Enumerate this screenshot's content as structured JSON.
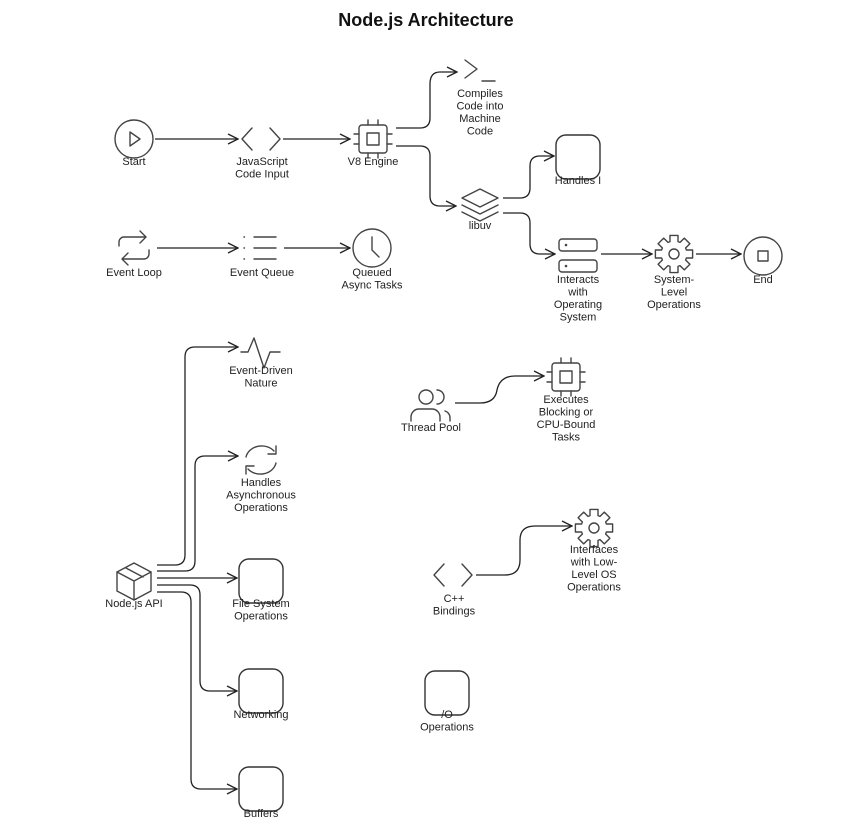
{
  "title": "Node.js Architecture",
  "nodes": {
    "start": {
      "label": [
        "Start"
      ],
      "icon": "play-circle-icon"
    },
    "js_input": {
      "label": [
        "JavaScript",
        "Code Input"
      ],
      "icon": "code-brackets-icon"
    },
    "v8": {
      "label": [
        "V8 Engine"
      ],
      "icon": "cpu-chip-icon"
    },
    "compiles": {
      "label": [
        "Compiles",
        "Code into",
        "Machine",
        "Code"
      ],
      "icon": "terminal-prompt-icon"
    },
    "libuv": {
      "label": [
        "libuv"
      ],
      "icon": "layers-icon"
    },
    "handles_io": {
      "label": [
        "Handles I"
      ],
      "icon": "rounded-box-icon"
    },
    "interacts_os": {
      "label": [
        "Interacts",
        "with",
        "Operating",
        "System"
      ],
      "icon": "server-stack-icon"
    },
    "system_ops": {
      "label": [
        "System-",
        "Level",
        "Operations"
      ],
      "icon": "gear-icon"
    },
    "end": {
      "label": [
        "End"
      ],
      "icon": "stop-circle-icon"
    },
    "event_loop": {
      "label": [
        "Event Loop"
      ],
      "icon": "repeat-arrows-icon"
    },
    "event_queue": {
      "label": [
        "Event Queue"
      ],
      "icon": "list-icon"
    },
    "queued_tasks": {
      "label": [
        "Queued",
        "Async Tasks"
      ],
      "icon": "clock-icon"
    },
    "event_driven": {
      "label": [
        "Event-Driven",
        "Nature"
      ],
      "icon": "pulse-icon"
    },
    "handles_async": {
      "label": [
        "Handles",
        "Asynchronous",
        "Operations"
      ],
      "icon": "refresh-icon"
    },
    "nodejs_api": {
      "label": [
        "Node.js API"
      ],
      "icon": "package-box-icon"
    },
    "file_system": {
      "label": [
        "File System",
        "Operations"
      ],
      "icon": "rounded-box-icon"
    },
    "networking": {
      "label": [
        "Networking"
      ],
      "icon": "rounded-box-icon"
    },
    "buffers": {
      "label": [
        "Buffers"
      ],
      "icon": "rounded-box-icon"
    },
    "thread_pool": {
      "label": [
        "Thread Pool"
      ],
      "icon": "users-icon"
    },
    "executes_blocking": {
      "label": [
        "Executes",
        "Blocking or",
        "CPU-Bound",
        "Tasks"
      ],
      "icon": "cpu-chip-icon"
    },
    "cpp_bindings": {
      "label": [
        "C++",
        "Bindings"
      ],
      "icon": "code-brackets-icon"
    },
    "interfaces_os": {
      "label": [
        "Interfaces",
        "with Low-",
        "Level OS",
        "Operations"
      ],
      "icon": "gear-icon"
    },
    "io_ops": {
      "label": [
        "/O",
        "Operations"
      ],
      "icon": "rounded-box-icon"
    }
  },
  "edges": [
    [
      "start",
      "js_input"
    ],
    [
      "js_input",
      "v8"
    ],
    [
      "v8",
      "compiles"
    ],
    [
      "v8",
      "libuv"
    ],
    [
      "libuv",
      "handles_io"
    ],
    [
      "libuv",
      "interacts_os"
    ],
    [
      "interacts_os",
      "system_ops"
    ],
    [
      "system_ops",
      "end"
    ],
    [
      "event_loop",
      "event_queue"
    ],
    [
      "event_queue",
      "queued_tasks"
    ],
    [
      "nodejs_api",
      "event_driven"
    ],
    [
      "nodejs_api",
      "handles_async"
    ],
    [
      "nodejs_api",
      "file_system"
    ],
    [
      "nodejs_api",
      "networking"
    ],
    [
      "nodejs_api",
      "buffers"
    ],
    [
      "thread_pool",
      "executes_blocking"
    ],
    [
      "cpp_bindings",
      "interfaces_os"
    ]
  ]
}
